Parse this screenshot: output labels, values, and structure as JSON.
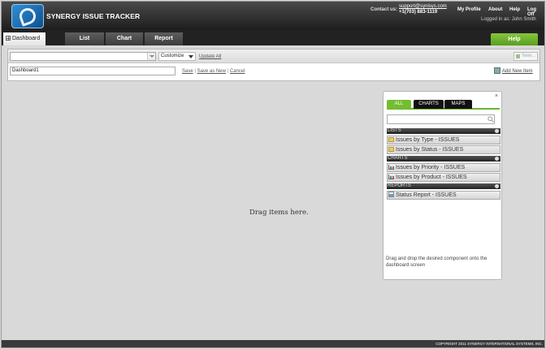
{
  "header": {
    "app_title": "SYNERGY ISSUE TRACKER",
    "contact_label": "Contact us:",
    "contact_email": "support@synisys.com",
    "contact_phone": "+1(703) 883-1119",
    "links": [
      "My Profile",
      "About",
      "Help",
      "Log Off"
    ],
    "logged_in": "Logged in as: John Smith"
  },
  "tabs": {
    "dashboard": "Dashboard",
    "list": "List",
    "chart": "Chart",
    "report": "Report",
    "help": "Help"
  },
  "toolbar": {
    "dashboard_select_value": "",
    "customize": "Customize",
    "update_all": "Update All",
    "new_button": "New...",
    "dashboard_name": "Dashboard1",
    "save": "Save",
    "save_as_new": "Save as New",
    "cancel": "Cancel",
    "add_new_item": "Add New Item"
  },
  "content": {
    "drop_text": "Drag items here."
  },
  "panel": {
    "close": "×",
    "tabs": [
      "ALL",
      "CHARTS",
      "MAPS"
    ],
    "active_tab": "ALL",
    "search_value": "",
    "sections": {
      "lists": {
        "title": "LISTS",
        "items": [
          "Issues by Type - ISSUES",
          "Issues by Status - ISSUES"
        ]
      },
      "charts": {
        "title": "CHARTS",
        "items": [
          "Issues by Priority - ISSUES",
          "Issues by Product - ISSUES"
        ]
      },
      "reports": {
        "title": "REPORTS",
        "items": [
          "Status Report - ISSUES"
        ]
      }
    },
    "hint": "Drag and drop the desired component onto the dashboard screen"
  },
  "footer": {
    "copyright": "COPYRIGHT 2011 SYNERGY INTERNATIONAL SYSTEMS, INC."
  },
  "colors": {
    "accent_green": "#6bb52a",
    "header_dark": "#1d1d1d"
  }
}
